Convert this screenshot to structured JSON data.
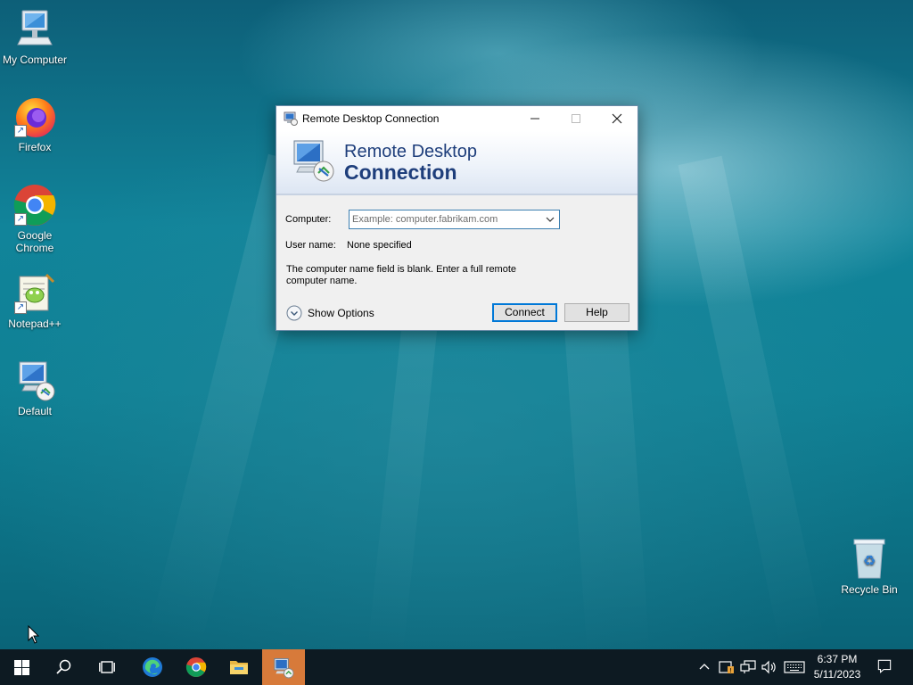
{
  "desktop": {
    "icons": [
      {
        "label": "My Computer",
        "icon": "computer-icon"
      },
      {
        "label": "Firefox",
        "icon": "firefox-icon"
      },
      {
        "label": "Google Chrome",
        "icon": "chrome-icon"
      },
      {
        "label": "Notepad++",
        "icon": "notepadpp-icon"
      },
      {
        "label": "Default",
        "icon": "rdp-file-icon"
      },
      {
        "label": "Recycle Bin",
        "icon": "recycle-bin-icon"
      }
    ]
  },
  "window": {
    "title": "Remote Desktop Connection",
    "banner_line1": "Remote Desktop",
    "banner_line2": "Connection",
    "computer_label": "Computer:",
    "computer_value": "",
    "computer_placeholder": "Example: computer.fabrikam.com",
    "username_label": "User name:",
    "username_value": "None specified",
    "message": "The computer name field is blank. Enter a full remote computer name.",
    "show_options_label": "Show Options",
    "connect_label": "Connect",
    "help_label": "Help"
  },
  "taskbar": {
    "apps": [
      "start-icon",
      "search-icon",
      "task-view-icon",
      "edge-icon",
      "chrome-icon",
      "file-explorer-icon",
      "remote-desktop-icon"
    ],
    "active_app": "remote-desktop-icon",
    "clock_time": "6:37 PM",
    "clock_date": "5/11/2023"
  },
  "colors": {
    "banner_text": "#1e3e7b",
    "taskbar": "#0d1a22",
    "active_taskbar_item": "#d77a3a",
    "input_focus_border": "#3c7fb1"
  }
}
